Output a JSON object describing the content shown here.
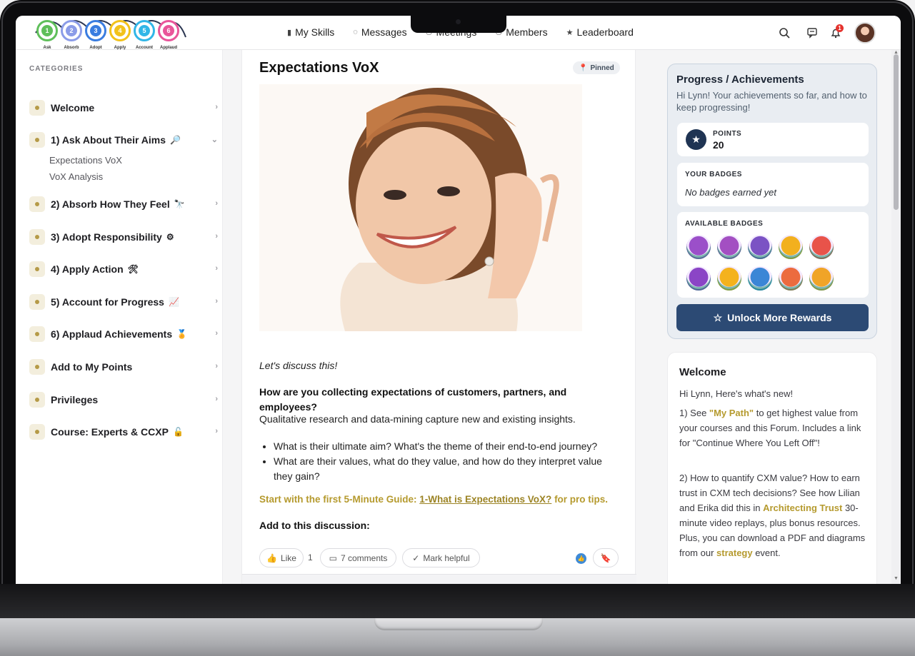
{
  "logo": {
    "steps": [
      {
        "num": "1",
        "word": "Ask",
        "color": "#5fbf5a"
      },
      {
        "num": "2",
        "word": "Absorb",
        "color": "#8b9ce8"
      },
      {
        "num": "3",
        "word": "Adopt",
        "color": "#3a7de0"
      },
      {
        "num": "4",
        "word": "Apply",
        "color": "#f2c21a"
      },
      {
        "num": "5",
        "word": "Account",
        "color": "#31b6e7"
      },
      {
        "num": "6",
        "word": "Applaud",
        "color": "#e9559a"
      }
    ]
  },
  "nav": {
    "links": [
      "My Skills",
      "Messages",
      "Meetings",
      "Members",
      "Leaderboard"
    ],
    "notifications_count": "1"
  },
  "sidebar": {
    "title": "CATEGORIES",
    "items": [
      {
        "label": "Welcome",
        "emoji": ""
      },
      {
        "label": "1) Ask About Their Aims",
        "emoji": "🔎"
      },
      {
        "label": "2) Absorb How They Feel",
        "emoji": "🔭"
      },
      {
        "label": "3) Adopt Responsibility",
        "emoji": "⚙"
      },
      {
        "label": "4) Apply Action",
        "emoji": "🛠"
      },
      {
        "label": "5) Account for Progress",
        "emoji": "📈"
      },
      {
        "label": "6) Applaud Achievements",
        "emoji": "🏅"
      },
      {
        "label": "Add to My Points",
        "emoji": ""
      },
      {
        "label": "Privileges",
        "emoji": ""
      },
      {
        "label": "Course: Experts & CCXP",
        "emoji": "🔓"
      }
    ],
    "subitems": [
      "Expectations VoX",
      "VoX Analysis"
    ]
  },
  "post": {
    "title": "Expectations VoX",
    "pinned_label": "Pinned",
    "intro": "Let's discuss this!",
    "question": "How are you collecting expectations of customers, partners, and employees?",
    "paragraph": "Qualitative research and data-mining capture new and existing insights.",
    "bullets": [
      "What is their ultimate aim? What's the theme of their end-to-end journey?",
      "What are their values, what do they value, and how do they interpret value they gain?"
    ],
    "guide_prefix": "Start with the first 5-Minute Guide: ",
    "guide_link": "1-What is Expectations VoX?",
    "guide_suffix": " for pro tips.",
    "add_discussion": "Add to this discussion:",
    "like_label": "Like",
    "like_count": "1",
    "comments_label": "7 comments",
    "helpful_label": "Mark helpful"
  },
  "progress": {
    "title": "Progress / Achievements",
    "subtitle": "Hi Lynn! Your achievements so far, and how to keep progressing!",
    "points_label": "POINTS",
    "points_value": "20",
    "badges_label": "YOUR BADGES",
    "badges_empty": "No badges earned yet",
    "available_label": "AVAILABLE BADGES",
    "available_badges": [
      {
        "color": "#9b4fc9"
      },
      {
        "color": "#a34fc2"
      },
      {
        "color": "#7b52c4"
      },
      {
        "color": "#f2b01e"
      },
      {
        "color": "#e8534a"
      },
      {
        "color": "#8b45c6"
      },
      {
        "color": "#f4b21d"
      },
      {
        "color": "#3b86d6"
      },
      {
        "color": "#ec6b3f"
      },
      {
        "color": "#f0a428"
      }
    ],
    "unlock_label": "Unlock More Rewards"
  },
  "welcome": {
    "title": "Welcome",
    "greeting": "Hi Lynn, Here's what's new!",
    "item1_a": "1) See ",
    "item1_link": "\"My Path\"",
    "item1_b": " to get highest value from your courses and this Forum. Includes a link for \"Continue Where You Left Off\"!",
    "item2_a": "2) How to quantify CXM value? How to earn trust in CXM tech decisions? See how Lilian and Erika did this in ",
    "item2_link": "Architecting Trust",
    "item2_b": " 30-minute video replays, plus bonus resources. Plus, you can download a PDF and diagrams from our ",
    "item2_link2": "strategy",
    "item2_c": " event."
  },
  "colors": {
    "accent_gold": "#b59a2e",
    "button_navy": "#2c4a74"
  }
}
